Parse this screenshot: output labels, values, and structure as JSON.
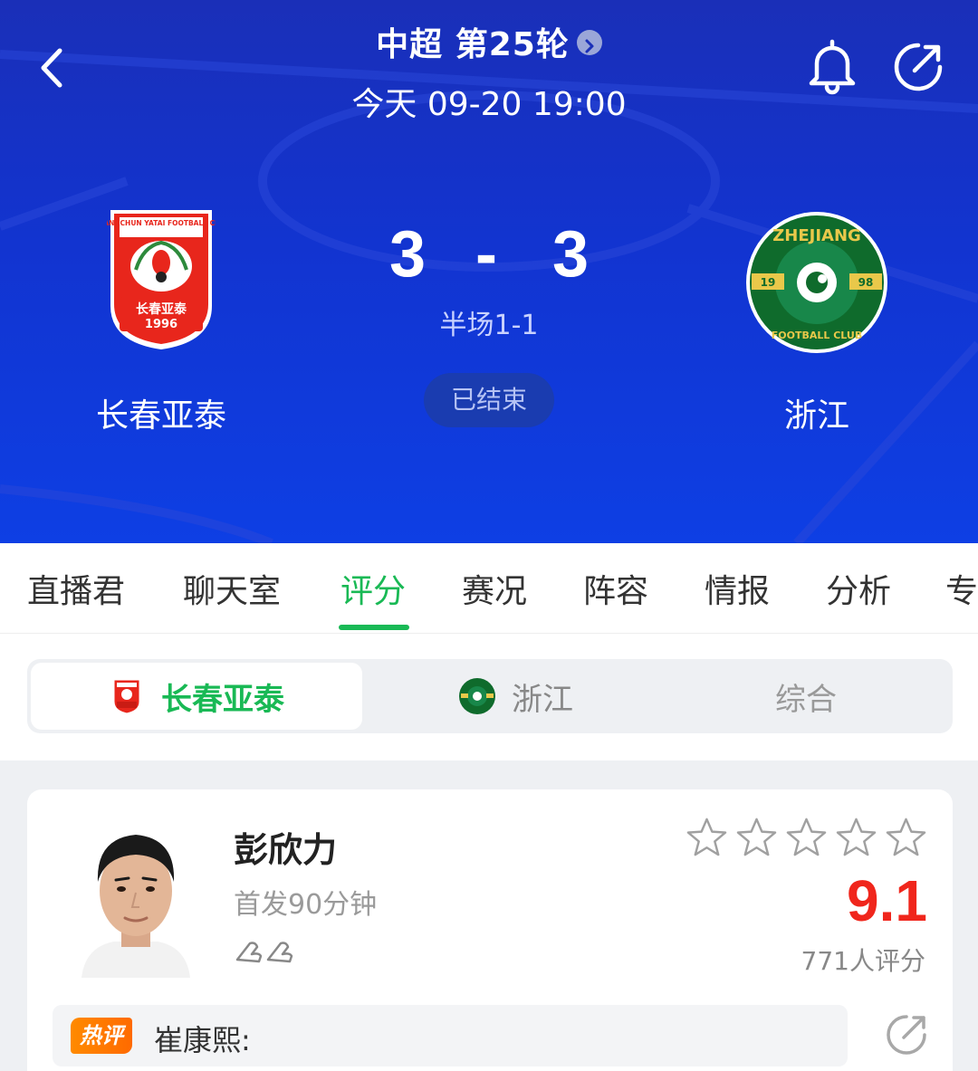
{
  "header": {
    "league_round": "中超 第25轮",
    "match_time": "今天 09-20 19:00"
  },
  "match": {
    "home": {
      "name": "长春亚泰",
      "score": "3",
      "crest_text": "长春亚泰",
      "crest_year": "1996",
      "crest_top": "CHANGCHUN YATAI FOOTBALL CLUB"
    },
    "away": {
      "name": "浙江",
      "score": "3",
      "crest_top": "ZHEJIANG",
      "crest_bottom": "FOOTBALL CLUB",
      "crest_left": "19",
      "crest_right": "98"
    },
    "separator": "-",
    "halftime": "半场1-1",
    "status": "已结束"
  },
  "tabs": [
    {
      "label": "直播君"
    },
    {
      "label": "聊天室"
    },
    {
      "label": "评分",
      "active": true
    },
    {
      "label": "赛况"
    },
    {
      "label": "阵容"
    },
    {
      "label": "情报"
    },
    {
      "label": "分析"
    },
    {
      "label": "专"
    }
  ],
  "team_switch": {
    "home_label": "长春亚泰",
    "away_label": "浙江",
    "overall_label": "综合",
    "selected": "home"
  },
  "player_card": {
    "name": "彭欣力",
    "detail": "首发90分钟",
    "rating": "9.1",
    "rating_count": "771人评分",
    "stars_filled": 0,
    "stars_total": 5,
    "hot_badge": "热评",
    "hot_comment": "崔康熙:"
  },
  "colors": {
    "accent": "#19b955",
    "rating": "#f0261c",
    "hero": "#1234d0"
  }
}
